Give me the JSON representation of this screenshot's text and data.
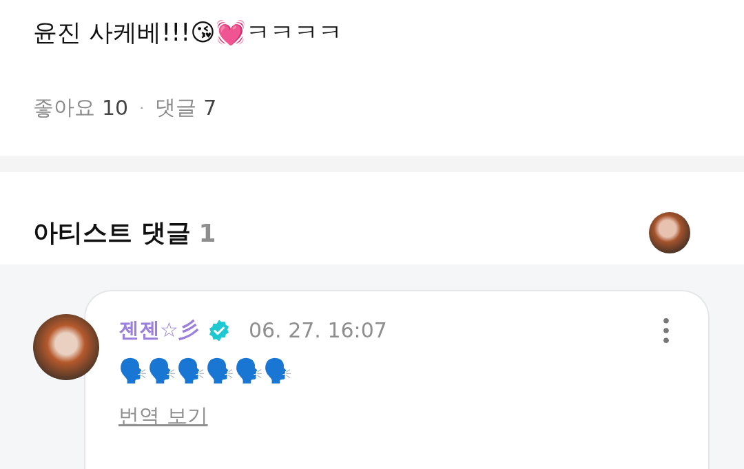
{
  "post": {
    "text": "윤진 사케베!!!😘💓ㅋㅋㅋㅋ",
    "likes_label": "좋아요",
    "likes_count": "10",
    "separator": "·",
    "comments_label": "댓글",
    "comments_count": "7"
  },
  "artist_comments": {
    "title": "아티스트 댓글",
    "count": "1",
    "comments": [
      {
        "author": "젠젠☆彡",
        "verified": true,
        "time": "06. 27. 16:07",
        "text": "🗣️🗣️🗣️🗣️🗣️🗣️",
        "translate_link": "번역 보기"
      }
    ]
  }
}
